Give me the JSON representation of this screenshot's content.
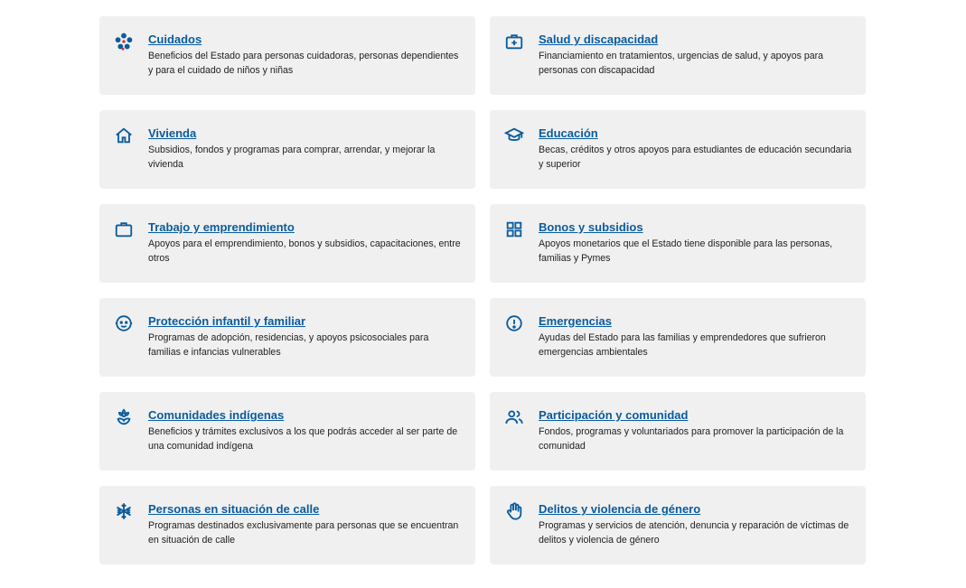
{
  "colors": {
    "accent": "#0a5c9e",
    "card_bg": "#f0f0f0",
    "text": "#222222"
  },
  "cards": [
    {
      "icon": "people-network-icon",
      "title": "Cuidados",
      "description": "Beneficios del Estado para personas cuidadoras, personas dependientes y para el cuidado de niños y niñas"
    },
    {
      "icon": "medical-briefcase-icon",
      "title": "Salud y discapacidad",
      "description": "Financiamiento en tratamientos, urgencias de salud, y apoyos para personas con discapacidad"
    },
    {
      "icon": "home-icon",
      "title": "Vivienda",
      "description": "Subsidios, fondos y programas para comprar, arrendar, y mejorar la vivienda"
    },
    {
      "icon": "graduation-cap-icon",
      "title": "Educación",
      "description": "Becas, créditos y otros apoyos para estudiantes de educación secundaria y superior"
    },
    {
      "icon": "briefcase-icon",
      "title": "Trabajo y emprendimiento",
      "description": "Apoyos para el emprendimiento, bonos y subsidios, capacitaciones, entre otros"
    },
    {
      "icon": "grid-icon",
      "title": "Bonos y subsidios",
      "description": "Apoyos monetarios que el Estado tiene disponible para las personas, familias y Pymes"
    },
    {
      "icon": "child-face-icon",
      "title": "Protección infantil y familiar",
      "description": "Programas de adopción, residencias, y apoyos psicosociales para familias e infancias vulnerables"
    },
    {
      "icon": "alert-circle-icon",
      "title": "Emergencias",
      "description": "Ayudas del Estado para las familias y emprendedores que sufrieron emergencias ambientales"
    },
    {
      "icon": "flower-icon",
      "title": "Comunidades indígenas",
      "description": "Beneficios y trámites exclusivos a los que podrás acceder al ser parte de una comunidad indígena"
    },
    {
      "icon": "group-icon",
      "title": "Participación y comunidad",
      "description": "Fondos, programas y voluntariados para promover la participación de la comunidad"
    },
    {
      "icon": "snowflake-icon",
      "title": "Personas en situación de calle",
      "description": "Programas destinados exclusivamente para personas que se encuentran en situación de calle"
    },
    {
      "icon": "raised-hand-icon",
      "title": "Delitos y violencia de género",
      "description": "Programas y servicios de atención, denuncia y reparación de víctimas de delitos y violencia de género"
    }
  ]
}
